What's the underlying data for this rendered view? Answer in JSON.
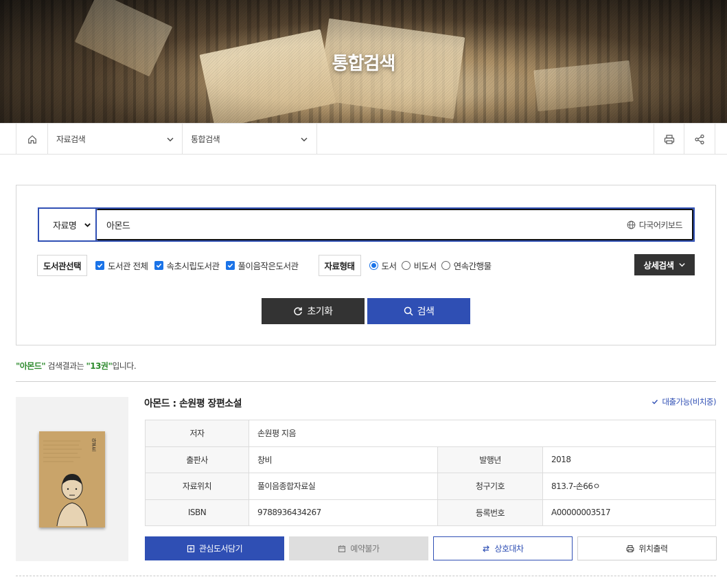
{
  "hero": {
    "title": "통합검색"
  },
  "breadcrumb": {
    "level1": "자료검색",
    "level2": "통합검색",
    "icons": [
      "home-icon",
      "chevron-down-icon",
      "print-icon",
      "share-icon"
    ]
  },
  "search": {
    "field_select": "자료명",
    "query": "아몬드",
    "keyboard_label": "다국어키보드",
    "library_label": "도서관선택",
    "libraries": [
      {
        "label": "도서관 전체",
        "checked": true
      },
      {
        "label": "속초시립도서관",
        "checked": true
      },
      {
        "label": "풀이음작은도서관",
        "checked": true
      }
    ],
    "type_label": "자료형태",
    "types": [
      {
        "label": "도서",
        "selected": true
      },
      {
        "label": "비도서",
        "selected": false
      },
      {
        "label": "연속간행물",
        "selected": false
      }
    ],
    "detail_label": "상세검색",
    "reset_label": "초기화",
    "search_label": "검색"
  },
  "summary": {
    "query_quoted": "\"아몬드\"",
    "mid": " 검색결과는 ",
    "count_quoted": "\"13권\"",
    "tail": "입니다."
  },
  "result": {
    "title": "아몬드 : 손원평 장편소설",
    "availability": "대출가능(비치중)",
    "cover_text": "아몬드",
    "rows": {
      "author_label": "저자",
      "author": "손원평 지음",
      "publisher_label": "출판사",
      "publisher": "창비",
      "year_label": "발행년",
      "year": "2018",
      "location_label": "자료위치",
      "location": "풀이음종합자료실",
      "callno_label": "청구기호",
      "callno": "813.7-손66ㅇ",
      "isbn_label": "ISBN",
      "isbn": "9788936434267",
      "regno_label": "등록번호",
      "regno": "A00000003517"
    },
    "actions": {
      "favorite": "관심도서담기",
      "reserve": "예약불가",
      "interlibrary": "상호대차",
      "print_location": "위치출력"
    }
  },
  "colors": {
    "primary": "#2f4fb4",
    "dark": "#333333",
    "green": "#2e8b2e"
  }
}
